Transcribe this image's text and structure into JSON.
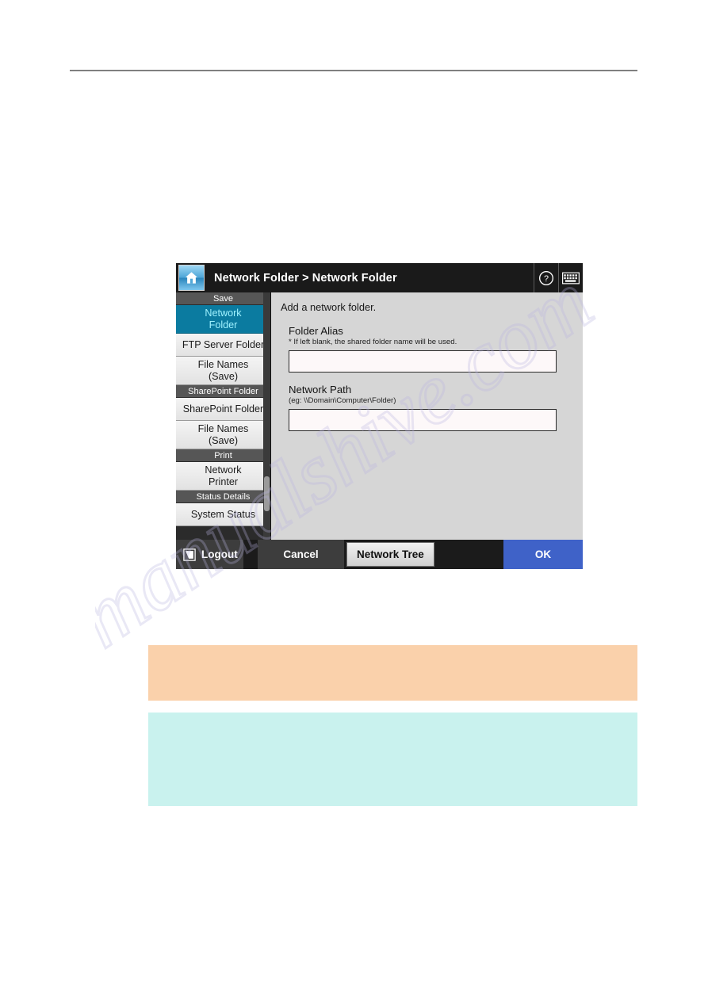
{
  "document": {
    "rule_present": true
  },
  "device": {
    "header": {
      "home_icon": "home-icon",
      "breadcrumb": "Network Folder > Network Folder",
      "help_icon": "help-question-icon",
      "keyboard_icon": "keyboard-icon"
    },
    "sidebar": {
      "groups": [
        {
          "label": "Save",
          "items": [
            {
              "label": "Network\nFolder",
              "line1": "Network",
              "line2": "Folder",
              "selected": true
            },
            {
              "label": "FTP Server Folder",
              "line1": "FTP Server Folder",
              "line2": "",
              "selected": false
            },
            {
              "label": "File Names (Save)",
              "line1": "File Names",
              "line2": "(Save)",
              "selected": false
            }
          ]
        },
        {
          "label": "SharePoint Folder",
          "items": [
            {
              "label": "SharePoint Folder",
              "line1": "SharePoint Folder",
              "line2": "",
              "selected": false
            },
            {
              "label": "File Names (Save)",
              "line1": "File Names",
              "line2": "(Save)",
              "selected": false
            }
          ]
        },
        {
          "label": "Print",
          "items": [
            {
              "label": "Network Printer",
              "line1": "Network",
              "line2": "Printer",
              "selected": false
            }
          ]
        },
        {
          "label": "Status Details",
          "items": [
            {
              "label": "System Status",
              "line1": "System Status",
              "line2": "",
              "selected": false
            }
          ]
        }
      ],
      "scrollbar": {
        "name": "sidebar-scrollbar"
      }
    },
    "content": {
      "title": "Add a network folder.",
      "fields": [
        {
          "label": "Folder Alias",
          "hint": "* If left blank, the shared folder name will be used.",
          "value": "",
          "placeholder": ""
        },
        {
          "label": "Network Path",
          "hint": "(eg: \\\\Domain\\Computer\\Folder)",
          "value": "",
          "placeholder": ""
        }
      ]
    },
    "footer": {
      "logout_label": "Logout",
      "logout_icon": "logout-page-icon",
      "cancel_label": "Cancel",
      "network_tree_label": "Network Tree",
      "ok_label": "OK"
    },
    "colors": {
      "selected_item_bg": "#0b7ba0",
      "selected_item_text": "#9ff2ff",
      "ok_button_bg": "#3f62c8",
      "group_header_bg": "#565656",
      "panel_bg": "#d6d6d6",
      "field_bg": "#fdf8f9"
    }
  },
  "callouts": [
    {
      "name": "attention-box",
      "color": "#fad1ab",
      "text": ""
    },
    {
      "name": "hint-box",
      "color": "#c9f2ee",
      "text": ""
    }
  ],
  "watermark": {
    "text": "manualshive.com",
    "color": "#b9b4e0"
  }
}
